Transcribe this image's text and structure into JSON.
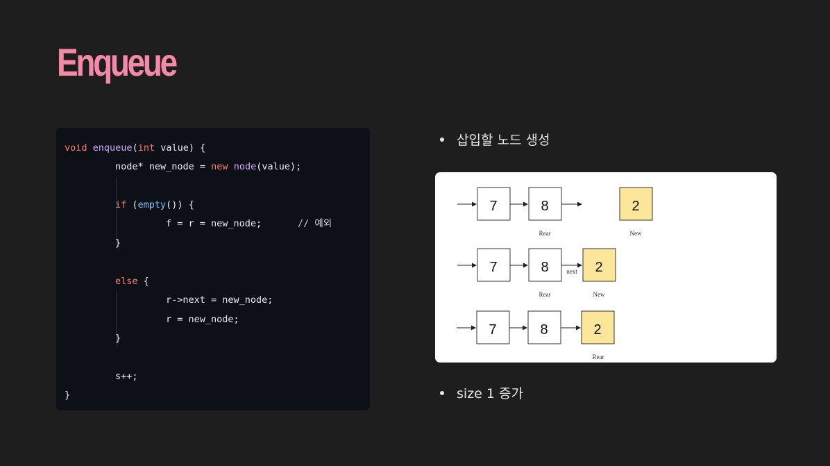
{
  "title": "Enqueue",
  "code_lines": [
    "void enqueue(int value) {",
    "node* new_node = new node(value);",
    "if (empty()) {",
    "f = r = new_node;",
    "// 예외",
    "}",
    "else {",
    "r->next = new_node;",
    "r = new_node;",
    "}",
    "s++;",
    "}"
  ],
  "bullets": [
    "삽입할 노드 생성",
    "size 1 증가"
  ],
  "diagram": {
    "rows": [
      {
        "nodes": [
          "7",
          "8",
          "2"
        ],
        "labels": [
          "Rear",
          "New"
        ]
      },
      {
        "nodes": [
          "7",
          "8",
          "2"
        ],
        "labels": [
          "Rear",
          "New"
        ],
        "edge_label": "next"
      },
      {
        "nodes": [
          "7",
          "8",
          "2"
        ],
        "labels": [
          "Rear"
        ]
      }
    ],
    "new_node_color": "#fbe69a",
    "node_color": "#ffffff"
  }
}
